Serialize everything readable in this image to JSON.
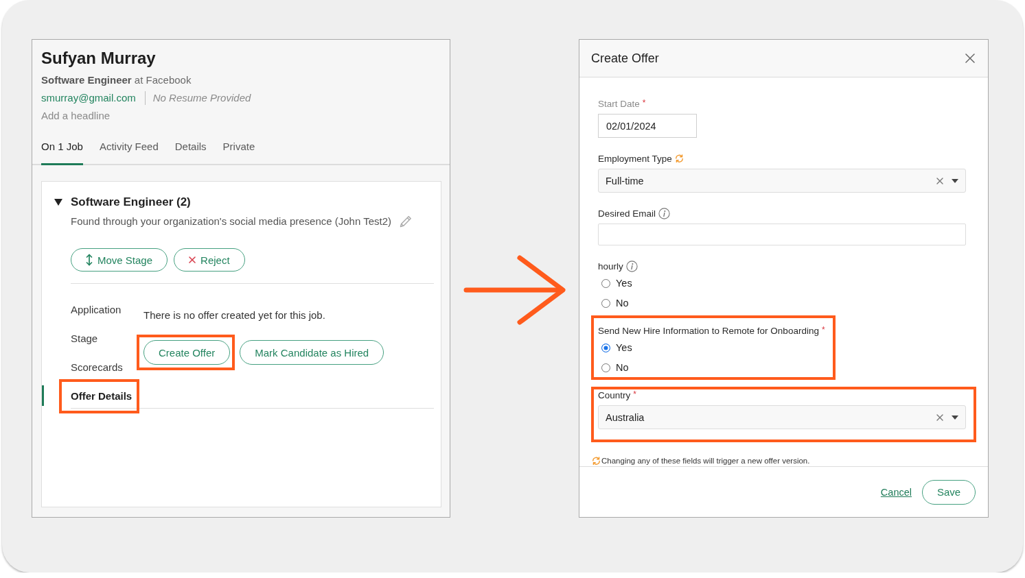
{
  "candidate": {
    "name": "Sufyan Murray",
    "headline": "**Software Engineer** at Facebook",
    "email": "smurray@gmail.com",
    "resume": "No Resume Provided",
    "add_headline": "Add a headline",
    "tabs": [
      {
        "label": "On 1 Job",
        "selected": true
      },
      {
        "label": "Activity Feed",
        "selected": false
      },
      {
        "label": "Details",
        "selected": false
      },
      {
        "label": "Private",
        "selected": false
      }
    ]
  },
  "job": {
    "title": "Software Engineer (2)",
    "expanded": true,
    "source": "Found through your organization's social media presence (John Test2)",
    "actions": [
      {
        "kind": "move",
        "label": "Move Stage"
      },
      {
        "kind": "reject",
        "label": "Reject"
      }
    ],
    "sections": [
      {
        "label": "Application",
        "selected": false,
        "highlighted": false
      },
      {
        "label": "Stage",
        "selected": false,
        "highlighted": false
      },
      {
        "label": "Scorecards",
        "selected": false,
        "highlighted": false
      },
      {
        "label": "Offer Details",
        "selected": true,
        "highlighted": true
      }
    ],
    "message": "There is no offer created yet for this job.",
    "offer_actions": [
      {
        "label": "Create Offer",
        "highlighted": true
      },
      {
        "label": "Mark Candidate as Hired",
        "highlighted": false
      }
    ]
  },
  "modal": {
    "title": "Create Offer",
    "fields": [
      {
        "kind": "date",
        "label": "Start Date",
        "required_mark": "*",
        "disabled": true,
        "info": false,
        "triggers_new_version": false,
        "highlighted": false,
        "value": "02/01/2024"
      },
      {
        "kind": "select",
        "label": "Employment Type",
        "disabled": false,
        "info": false,
        "triggers_new_version": true,
        "highlighted": false,
        "value": "Full-time"
      },
      {
        "kind": "text",
        "label": "Desired Email",
        "disabled": false,
        "info": true,
        "triggers_new_version": false,
        "highlighted": false
      },
      {
        "kind": "radio",
        "label": "hourly",
        "disabled": false,
        "info": true,
        "triggers_new_version": false,
        "highlighted": false,
        "options": [
          {
            "label": "Yes",
            "selected": false
          },
          {
            "label": "No",
            "selected": false
          }
        ]
      },
      {
        "kind": "radio",
        "label": "Send New Hire Information to Remote for Onboarding",
        "required_mark": "*",
        "disabled": false,
        "info": false,
        "triggers_new_version": false,
        "highlighted": true,
        "options": [
          {
            "label": "Yes",
            "selected": true
          },
          {
            "label": "No",
            "selected": false
          }
        ]
      },
      {
        "kind": "select",
        "label": "Country",
        "required_mark": "*",
        "disabled": false,
        "info": false,
        "triggers_new_version": false,
        "highlighted": true,
        "value": "Australia"
      }
    ],
    "note": "Changing any of these fields will trigger a new offer version.",
    "cancel": "Cancel",
    "save": "Save"
  }
}
